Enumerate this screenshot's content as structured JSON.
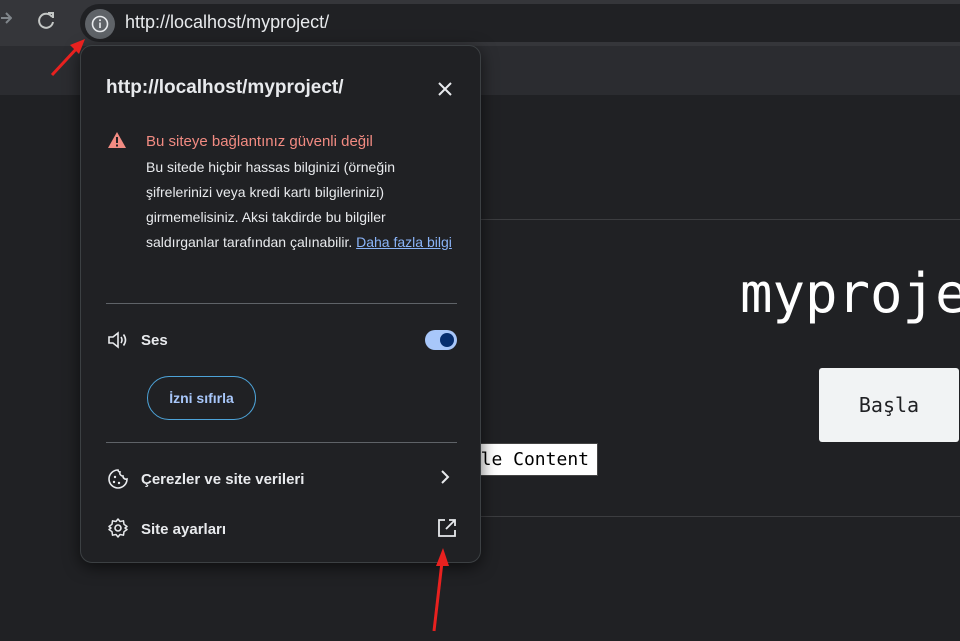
{
  "browser": {
    "url": "http://localhost/myproject/",
    "icons": {
      "forward": "arrow-right-icon",
      "reload": "reload-icon",
      "site_info": "info-icon"
    }
  },
  "page": {
    "title": "myproje",
    "start_button": "Başla",
    "content_chip": "le Content"
  },
  "site_info_popup": {
    "title": "http://localhost/myproject/",
    "warning": {
      "title": "Bu siteye bağlantınız güvenli değil",
      "body": "Bu sitede hiçbir hassas bilginizi (örneğin şifrelerinizi veya kredi kartı bilgilerinizi) girmemelisiniz. Aksi takdirde bu bilgiler saldırganlar tarafından çalınabilir.",
      "link": "Daha fazla bilgi"
    },
    "sound": {
      "label": "Ses",
      "enabled": true
    },
    "reset_permission": "İzni sıfırla",
    "cookies": "Çerezler ve site verileri",
    "site_settings": "Site ayarları"
  },
  "colors": {
    "warning": "#f28b82",
    "toggle_on": "#a8c7fa",
    "link": "#8ab4f8",
    "annotation_arrow": "#e8211f"
  }
}
